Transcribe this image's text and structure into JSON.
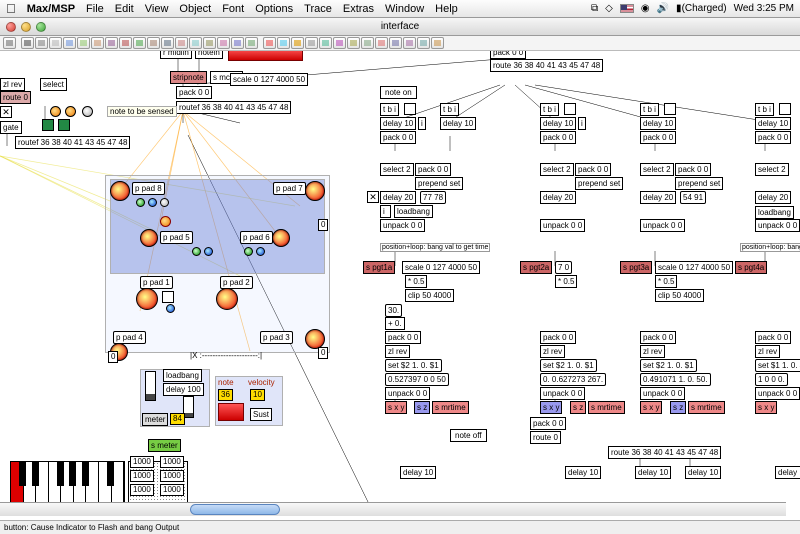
{
  "menubar": {
    "apple": "",
    "app": "Max/MSP",
    "items": [
      "File",
      "Edit",
      "View",
      "Object",
      "Font",
      "Options",
      "Trace",
      "Extras",
      "Window",
      "Help"
    ],
    "status": {
      "flag": "us",
      "speaker": "🔊",
      "battery": "(Charged)",
      "clock": "Wed 3:25 PM"
    }
  },
  "window": {
    "title": "interface"
  },
  "objects": {
    "r_midiin": "r midiin",
    "notein": "notein",
    "stripnote": "stripnote",
    "s_mcval": "s mcval",
    "pack00_a": "pack 0 0",
    "route_a": "route 36 38 40 41 43 45 47 48",
    "scale_a": "scale 0 127 4000 50",
    "routeF_a": "routef 36 38 40 41 43 45 47 48",
    "select_a": "select",
    "zl_rev_a": "zl rev",
    "route0": "route 0",
    "gate": "gate",
    "routeF_b": "routef 36 38 40 41 43 45 47 48",
    "note_sense": "note to be sensed",
    "ppad1": "p pad 1",
    "ppad2": "p pad 2",
    "ppad3": "p pad 3",
    "ppad4": "p pad 4",
    "ppad5": "p pad 5",
    "ppad6": "p pad 6",
    "ppad7": "p pad 7",
    "ppad8": "p pad 8",
    "loadbang_a": "loadbang",
    "delay100": "delay 100",
    "meter84": "84",
    "smeter": "s meter",
    "note_lbl": "note",
    "vel_lbl": "velocity",
    "sust": "Sust",
    "noteon": "note on",
    "noteoff": "note off",
    "tbi": "t b i",
    "delay10": "delay 10",
    "delay20": "delay 20",
    "pack00": "pack 0 0",
    "select2": "select 2",
    "prepend_set": "prepend set",
    "pval1": "77 78",
    "pval2": "54 91",
    "unpack00": "unpack 0 0",
    "posloop": "position+loop: bang val to get time",
    "scale_b": "scale 0 127 4000 50",
    "times05": "* 0.5",
    "clip50": "clip 50 4000",
    "plus0": "+ 0.",
    "zlrev": "zl rev",
    "set21": "set $2 1. 0. $1",
    "numlong1": "0.527397 0 0 50",
    "numlong2": "0. 0.627273 267.",
    "numlong3": "0.491071 1. 0. 50.",
    "sxy": "s x y",
    "sz": "s z",
    "smrtime": "s mrtime",
    "iobj": "i",
    "n30": "30.",
    "route0b": "route 0",
    "spgt1": "s pgt1a",
    "spgt2": "s pgt2a",
    "spgt3": "s pgt3a",
    "spgt4": "s pgt4a",
    "thousand": "1000",
    "xdash": "|X :---------------------:|",
    "zero": "0"
  },
  "status": "button: Cause Indicator to Flash and bang Output"
}
